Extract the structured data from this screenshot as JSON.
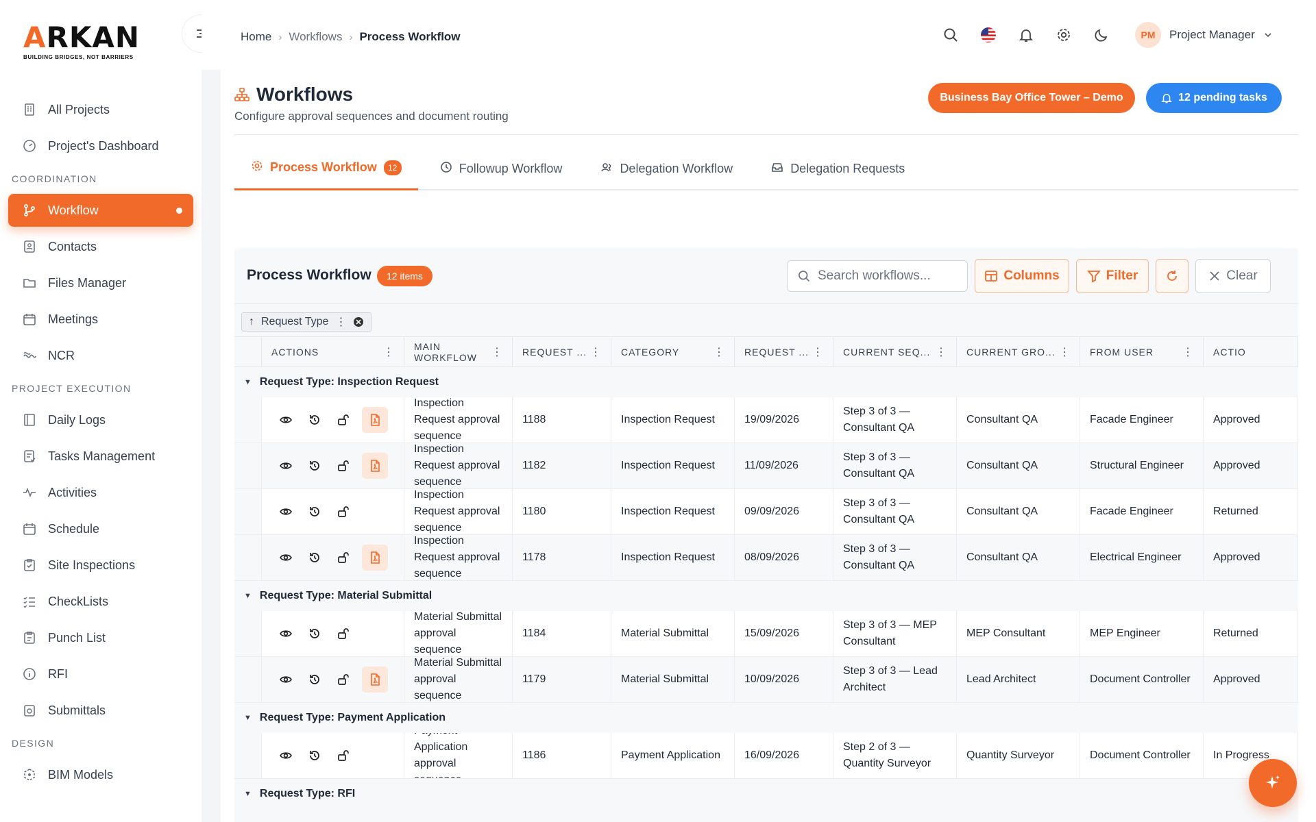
{
  "brand": {
    "name_prefix": "A",
    "name_rest": "RKAN",
    "tagline": "BUILDING BRIDGES, NOT BARRIERS"
  },
  "sidebar": {
    "top_items": [
      {
        "label": "All Projects",
        "icon": "building-icon"
      },
      {
        "label": "Project's Dashboard",
        "icon": "gauge-icon"
      }
    ],
    "sections": [
      {
        "title": "COORDINATION",
        "items": [
          {
            "label": "Workflow",
            "icon": "workflow-icon",
            "active": true
          },
          {
            "label": "Contacts",
            "icon": "contacts-icon"
          },
          {
            "label": "Files Manager",
            "icon": "folder-icon"
          },
          {
            "label": "Meetings",
            "icon": "calendar-icon"
          },
          {
            "label": "NCR",
            "icon": "ncr-icon"
          }
        ]
      },
      {
        "title": "PROJECT EXECUTION",
        "items": [
          {
            "label": "Daily Logs",
            "icon": "book-icon"
          },
          {
            "label": "Tasks Management",
            "icon": "task-icon"
          },
          {
            "label": "Activities",
            "icon": "activity-icon"
          },
          {
            "label": "Schedule",
            "icon": "calendar-icon"
          },
          {
            "label": "Site Inspections",
            "icon": "clipboard-check-icon"
          },
          {
            "label": "CheckLists",
            "icon": "checklist-icon"
          },
          {
            "label": "Punch List",
            "icon": "clipboard-icon"
          },
          {
            "label": "RFI",
            "icon": "info-icon"
          },
          {
            "label": "Submittals",
            "icon": "submittal-icon"
          }
        ]
      },
      {
        "title": "DESIGN",
        "items": [
          {
            "label": "BIM Models",
            "icon": "cube-icon"
          }
        ]
      }
    ]
  },
  "breadcrumb": {
    "home": "Home",
    "section": "Workflows",
    "current": "Process Workflow"
  },
  "user": {
    "initials": "PM",
    "name": "Project Manager"
  },
  "page": {
    "title": "Workflows",
    "subtitle": "Configure approval sequences and document routing",
    "project_button": "Business Bay Office Tower – Demo",
    "pending_button": "12 pending tasks"
  },
  "tabs": [
    {
      "label": "Process Workflow",
      "badge": "12",
      "active": true,
      "icon": "gear-icon"
    },
    {
      "label": "Followup Workflow",
      "icon": "clock-icon"
    },
    {
      "label": "Delegation Workflow",
      "icon": "users-icon"
    },
    {
      "label": "Delegation Requests",
      "icon": "inbox-icon"
    }
  ],
  "grid": {
    "title": "Process Workflow",
    "count_badge": "12 items",
    "search_placeholder": "Search workflows...",
    "buttons": {
      "columns": "Columns",
      "filter": "Filter",
      "clear": "Clear"
    },
    "group_chip": "Request Type",
    "columns": [
      "ACTIONS",
      "MAIN WORKFLOW",
      "REQUEST ...",
      "CATEGORY",
      "REQUEST ...",
      "CURRENT SEQ...",
      "CURRENT GRO...",
      "FROM USER",
      "ACTIO"
    ],
    "groups": [
      {
        "label": "Request Type: Inspection Request",
        "rows": [
          {
            "main": "Inspection Request approval sequence",
            "req": "1188",
            "cat": "Inspection Request",
            "date": "19/09/2026",
            "seq": "Step 3 of 3 — Consultant QA",
            "group": "Consultant QA",
            "from": "Facade Engineer",
            "action": "Approved",
            "pdf": true
          },
          {
            "main": "Inspection Request approval sequence",
            "req": "1182",
            "cat": "Inspection Request",
            "date": "11/09/2026",
            "seq": "Step 3 of 3 — Consultant QA",
            "group": "Consultant QA",
            "from": "Structural Engineer",
            "action": "Approved",
            "pdf": true
          },
          {
            "main": "Inspection Request approval sequence",
            "req": "1180",
            "cat": "Inspection Request",
            "date": "09/09/2026",
            "seq": "Step 3 of 3 — Consultant QA",
            "group": "Consultant QA",
            "from": "Facade Engineer",
            "action": "Returned",
            "pdf": false
          },
          {
            "main": "Inspection Request approval sequence",
            "req": "1178",
            "cat": "Inspection Request",
            "date": "08/09/2026",
            "seq": "Step 3 of 3 — Consultant QA",
            "group": "Consultant QA",
            "from": "Electrical Engineer",
            "action": "Approved",
            "pdf": true
          }
        ]
      },
      {
        "label": "Request Type: Material Submittal",
        "rows": [
          {
            "main": "Material Submittal approval sequence",
            "req": "1184",
            "cat": "Material Submittal",
            "date": "15/09/2026",
            "seq": "Step 3 of 3 — MEP Consultant",
            "group": "MEP Consultant",
            "from": "MEP Engineer",
            "action": "Returned",
            "pdf": false
          },
          {
            "main": "Material Submittal approval sequence",
            "req": "1179",
            "cat": "Material Submittal",
            "date": "10/09/2026",
            "seq": "Step 3 of 3 — Lead Architect",
            "group": "Lead Architect",
            "from": "Document Controller",
            "action": "Approved",
            "pdf": true
          }
        ]
      },
      {
        "label": "Request Type: Payment Application",
        "rows": [
          {
            "main": "Payment Application approval sequence",
            "req": "1186",
            "cat": "Payment Application",
            "date": "16/09/2026",
            "seq": "Step 2 of 3 — Quantity Surveyor",
            "group": "Quantity Surveyor",
            "from": "Document Controller",
            "action": "In Progress",
            "pdf": false
          }
        ]
      },
      {
        "label": "Request Type: RFI",
        "rows": []
      }
    ]
  },
  "colors": {
    "accent": "#f26a2a",
    "blue": "#2e86f0"
  }
}
